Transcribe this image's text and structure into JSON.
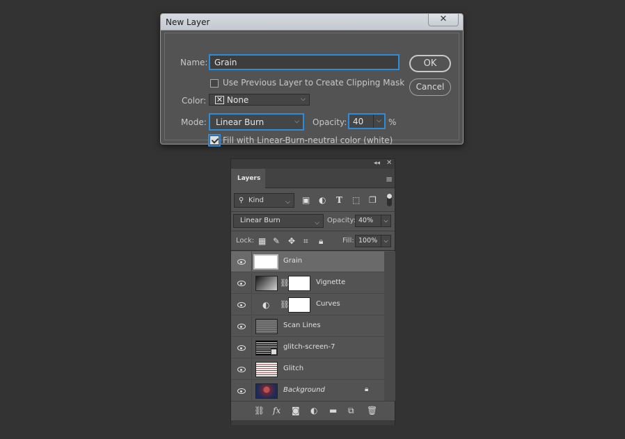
{
  "dialog": {
    "title": "New Layer",
    "close_glyph": "✕",
    "name_label": "Name:",
    "name_value": "Grain",
    "clipping_mask_label": "Use Previous Layer to Create Clipping Mask",
    "clipping_mask_checked": false,
    "color_label": "Color:",
    "color_value": "None",
    "mode_label": "Mode:",
    "mode_value": "Linear Burn",
    "opacity_label": "Opacity:",
    "opacity_value": "40",
    "opacity_unit": "%",
    "fill_neutral_label": "Fill with Linear-Burn-neutral color (white)",
    "fill_neutral_checked": true,
    "ok_label": "OK",
    "cancel_label": "Cancel"
  },
  "layers_panel": {
    "tab_label": "Layers",
    "filter_kind": "Kind",
    "blend_mode": "Linear Burn",
    "opacity_label": "Opacity:",
    "opacity_value": "40%",
    "lock_label": "Lock:",
    "fill_label": "Fill:",
    "fill_value": "100%",
    "layers": [
      {
        "name": "Grain",
        "selected": true,
        "thumb": "white"
      },
      {
        "name": "Vignette",
        "selected": false,
        "thumb": "gradient",
        "mask": true
      },
      {
        "name": "Curves",
        "selected": false,
        "thumb": "adjustment",
        "mask": true
      },
      {
        "name": "Scan Lines",
        "selected": false,
        "thumb": "lines"
      },
      {
        "name": "glitch-screen-7",
        "selected": false,
        "thumb": "glitch-smart"
      },
      {
        "name": "Glitch",
        "selected": false,
        "thumb": "glitch"
      },
      {
        "name": "Background",
        "selected": false,
        "thumb": "photo",
        "locked": true
      }
    ]
  },
  "colors": {
    "background": "#333333",
    "panel": "#535353",
    "focus": "#2e8ddb",
    "selected_row": "#6a6a6a"
  }
}
